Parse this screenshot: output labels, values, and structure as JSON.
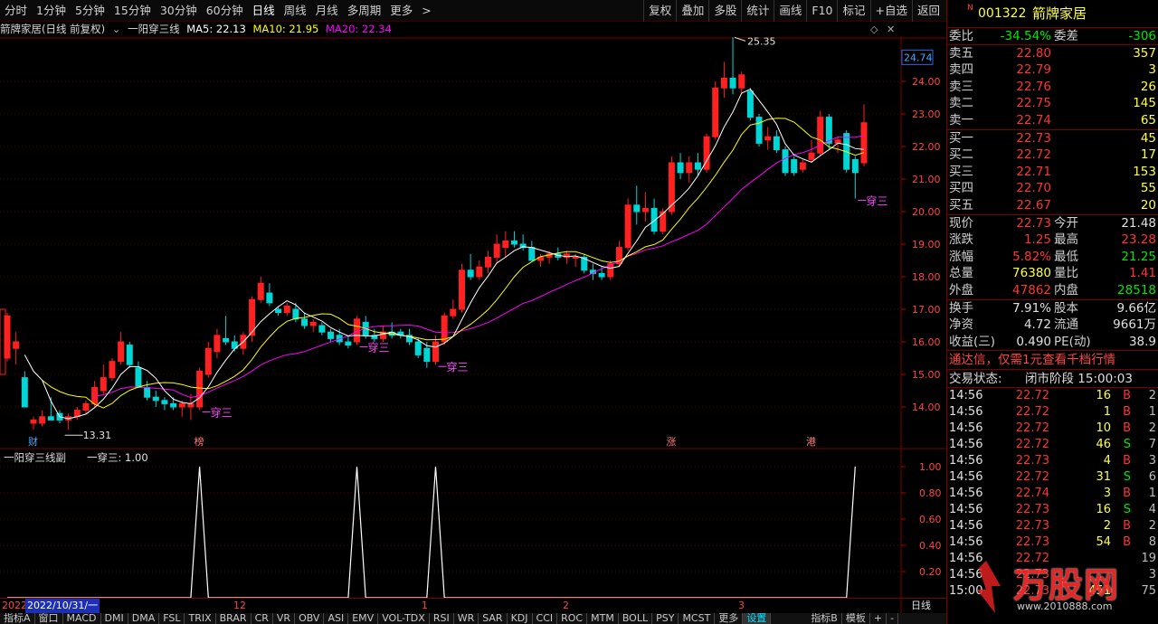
{
  "toolbar": {
    "periods": [
      "分时",
      "1分钟",
      "5分钟",
      "15分钟",
      "30分钟",
      "60分钟",
      "日线",
      "周线",
      "月线",
      "多周期",
      "更多"
    ],
    "active_period": "日线",
    "more_arrow": ">",
    "buttons": [
      "复权",
      "叠加",
      "多股",
      "统计",
      "画线",
      "F10",
      "标记",
      "+自选",
      "返回"
    ]
  },
  "header": {
    "title": "箭牌家居(日线 前复权)",
    "indicator": "一阳穿三线",
    "ma5": "MA5: 22.13",
    "ma10": "MA10: 21.95",
    "ma20": "MA20: 22.34",
    "ma5_color": "#ffffff",
    "ma10_color": "#ffff00",
    "ma20_color": "#ff00ff"
  },
  "main_chart": {
    "y_ticks": [
      "24.00",
      "23.00",
      "22.00",
      "21.00",
      "20.00",
      "19.00",
      "18.00",
      "17.00",
      "16.00",
      "15.00",
      "14.00"
    ],
    "current_price_tag": "24.74",
    "high_label": "25.35",
    "low_label": "13.31",
    "signal_label": "穿三",
    "markers": [
      "财",
      "榜",
      "涨",
      "港"
    ]
  },
  "sub_chart": {
    "title": "一阳穿三线副",
    "value_label": "一穿三: 1.00",
    "y_ticks": [
      "1.00",
      "0.80",
      "0.60",
      "0.40",
      "0.20"
    ]
  },
  "date_axis": {
    "labels": [
      "2022",
      "2022/10/31/一",
      "12",
      "1",
      "2",
      "3"
    ],
    "right_label": "日线"
  },
  "bottom_tabs": [
    "指标A",
    "窗口",
    "MACD",
    "DMI",
    "DMA",
    "FSL",
    "TRIX",
    "BRAR",
    "CR",
    "VR",
    "OBV",
    "ASI",
    "EMV",
    "VOL-TDX",
    "RSI",
    "WR",
    "SAR",
    "KDJ",
    "CCI",
    "ROC",
    "MTM",
    "BOLL",
    "PSY",
    "MCST",
    "更多",
    "设置",
    "指标B",
    "模板",
    "+",
    "-"
  ],
  "chart_data": {
    "type": "candlestick",
    "title": "箭牌家居(日线 前复权)",
    "ylim": [
      13.2,
      25.6
    ],
    "candles": [
      {
        "o": 15.5,
        "h": 16.9,
        "l": 15.4,
        "c": 16.8
      },
      {
        "o": 15.8,
        "h": 16.3,
        "l": 15.3,
        "c": 16.0
      },
      {
        "o": 14.9,
        "h": 15.1,
        "l": 14.0,
        "c": 14.0
      },
      {
        "o": 13.5,
        "h": 13.7,
        "l": 13.31,
        "c": 13.6
      },
      {
        "o": 13.5,
        "h": 13.9,
        "l": 13.4,
        "c": 13.7
      },
      {
        "o": 13.7,
        "h": 14.3,
        "l": 13.6,
        "c": 13.6
      },
      {
        "o": 13.8,
        "h": 13.9,
        "l": 13.5,
        "c": 13.6
      },
      {
        "o": 13.6,
        "h": 13.8,
        "l": 13.3,
        "c": 13.7
      },
      {
        "o": 13.7,
        "h": 14.0,
        "l": 13.6,
        "c": 13.9
      },
      {
        "o": 13.9,
        "h": 14.2,
        "l": 13.8,
        "c": 14.1
      },
      {
        "o": 14.1,
        "h": 14.8,
        "l": 14.0,
        "c": 14.6
      },
      {
        "o": 14.5,
        "h": 15.3,
        "l": 14.4,
        "c": 14.9
      },
      {
        "o": 14.9,
        "h": 15.5,
        "l": 14.8,
        "c": 15.4
      },
      {
        "o": 15.4,
        "h": 16.3,
        "l": 15.3,
        "c": 16.0
      },
      {
        "o": 15.9,
        "h": 16.0,
        "l": 15.2,
        "c": 15.3
      },
      {
        "o": 15.2,
        "h": 15.4,
        "l": 14.6,
        "c": 14.6
      },
      {
        "o": 14.6,
        "h": 14.8,
        "l": 14.2,
        "c": 14.3
      },
      {
        "o": 14.3,
        "h": 14.5,
        "l": 14.0,
        "c": 14.2
      },
      {
        "o": 14.2,
        "h": 14.3,
        "l": 13.9,
        "c": 14.1
      },
      {
        "o": 14.1,
        "h": 14.3,
        "l": 13.9,
        "c": 14.0
      },
      {
        "o": 14.0,
        "h": 14.2,
        "l": 13.7,
        "c": 14.1
      },
      {
        "o": 14.0,
        "h": 14.4,
        "l": 13.6,
        "c": 14.1
      },
      {
        "o": 14.0,
        "h": 15.2,
        "l": 13.9,
        "c": 15.1
      },
      {
        "o": 15.0,
        "h": 16.0,
        "l": 14.9,
        "c": 15.8
      },
      {
        "o": 15.7,
        "h": 16.4,
        "l": 15.5,
        "c": 16.2
      },
      {
        "o": 16.1,
        "h": 16.8,
        "l": 15.9,
        "c": 16.0
      },
      {
        "o": 16.0,
        "h": 16.2,
        "l": 15.7,
        "c": 15.8
      },
      {
        "o": 15.8,
        "h": 16.3,
        "l": 15.6,
        "c": 16.2
      },
      {
        "o": 16.2,
        "h": 17.4,
        "l": 16.0,
        "c": 17.3
      },
      {
        "o": 17.3,
        "h": 18.0,
        "l": 17.2,
        "c": 17.8
      },
      {
        "o": 17.5,
        "h": 17.8,
        "l": 17.1,
        "c": 17.2
      },
      {
        "o": 17.0,
        "h": 17.1,
        "l": 16.8,
        "c": 16.9
      },
      {
        "o": 16.9,
        "h": 17.2,
        "l": 16.8,
        "c": 17.1
      },
      {
        "o": 17.0,
        "h": 17.2,
        "l": 16.6,
        "c": 16.7
      },
      {
        "o": 16.7,
        "h": 16.9,
        "l": 16.4,
        "c": 16.5
      },
      {
        "o": 16.5,
        "h": 16.7,
        "l": 16.3,
        "c": 16.6
      },
      {
        "o": 16.5,
        "h": 16.6,
        "l": 16.2,
        "c": 16.3
      },
      {
        "o": 16.3,
        "h": 16.4,
        "l": 16.0,
        "c": 16.1
      },
      {
        "o": 16.2,
        "h": 16.4,
        "l": 15.9,
        "c": 16.0
      },
      {
        "o": 16.0,
        "h": 16.2,
        "l": 15.8,
        "c": 15.9
      },
      {
        "o": 16.0,
        "h": 16.8,
        "l": 15.9,
        "c": 16.7
      },
      {
        "o": 16.6,
        "h": 16.8,
        "l": 16.1,
        "c": 16.2
      },
      {
        "o": 16.2,
        "h": 16.4,
        "l": 16.0,
        "c": 16.1
      },
      {
        "o": 16.1,
        "h": 16.5,
        "l": 16.0,
        "c": 16.3
      },
      {
        "o": 16.3,
        "h": 16.6,
        "l": 16.1,
        "c": 16.2
      },
      {
        "o": 16.3,
        "h": 16.4,
        "l": 16.1,
        "c": 16.2
      },
      {
        "o": 16.2,
        "h": 16.4,
        "l": 15.9,
        "c": 16.0
      },
      {
        "o": 16.0,
        "h": 16.1,
        "l": 15.5,
        "c": 15.6
      },
      {
        "o": 15.8,
        "h": 16.0,
        "l": 15.2,
        "c": 15.4
      },
      {
        "o": 15.4,
        "h": 16.2,
        "l": 15.3,
        "c": 16.0
      },
      {
        "o": 16.0,
        "h": 16.9,
        "l": 15.9,
        "c": 16.8
      },
      {
        "o": 16.8,
        "h": 17.3,
        "l": 16.7,
        "c": 17.0
      },
      {
        "o": 17.0,
        "h": 18.4,
        "l": 16.9,
        "c": 18.2
      },
      {
        "o": 18.2,
        "h": 18.7,
        "l": 17.9,
        "c": 18.0
      },
      {
        "o": 18.0,
        "h": 18.5,
        "l": 17.9,
        "c": 18.3
      },
      {
        "o": 18.3,
        "h": 18.8,
        "l": 18.1,
        "c": 18.6
      },
      {
        "o": 18.6,
        "h": 19.3,
        "l": 18.4,
        "c": 19.0
      },
      {
        "o": 18.9,
        "h": 19.4,
        "l": 18.6,
        "c": 19.1
      },
      {
        "o": 19.1,
        "h": 19.4,
        "l": 18.9,
        "c": 19.0
      },
      {
        "o": 19.0,
        "h": 19.3,
        "l": 18.8,
        "c": 18.9
      },
      {
        "o": 18.9,
        "h": 19.1,
        "l": 18.5,
        "c": 18.5
      },
      {
        "o": 18.5,
        "h": 18.7,
        "l": 18.3,
        "c": 18.6
      },
      {
        "o": 18.6,
        "h": 18.8,
        "l": 18.4,
        "c": 18.7
      },
      {
        "o": 18.7,
        "h": 18.9,
        "l": 18.5,
        "c": 18.6
      },
      {
        "o": 18.6,
        "h": 18.8,
        "l": 18.4,
        "c": 18.7
      },
      {
        "o": 18.6,
        "h": 18.7,
        "l": 18.3,
        "c": 18.6
      },
      {
        "o": 18.6,
        "h": 18.7,
        "l": 18.1,
        "c": 18.2
      },
      {
        "o": 18.2,
        "h": 18.4,
        "l": 17.9,
        "c": 18.1
      },
      {
        "o": 18.1,
        "h": 18.3,
        "l": 17.9,
        "c": 18.0
      },
      {
        "o": 18.0,
        "h": 18.5,
        "l": 17.9,
        "c": 18.4
      },
      {
        "o": 18.4,
        "h": 19.1,
        "l": 18.3,
        "c": 18.9
      },
      {
        "o": 18.9,
        "h": 20.4,
        "l": 18.8,
        "c": 20.2
      },
      {
        "o": 20.2,
        "h": 20.8,
        "l": 19.6,
        "c": 20.0
      },
      {
        "o": 20.0,
        "h": 20.6,
        "l": 19.7,
        "c": 20.1
      },
      {
        "o": 20.1,
        "h": 20.4,
        "l": 19.3,
        "c": 19.4
      },
      {
        "o": 19.4,
        "h": 20.1,
        "l": 19.3,
        "c": 20.0
      },
      {
        "o": 20.0,
        "h": 21.7,
        "l": 19.9,
        "c": 21.5
      },
      {
        "o": 21.5,
        "h": 21.8,
        "l": 21.0,
        "c": 21.2
      },
      {
        "o": 21.2,
        "h": 21.7,
        "l": 20.9,
        "c": 21.5
      },
      {
        "o": 21.5,
        "h": 21.8,
        "l": 21.1,
        "c": 21.3
      },
      {
        "o": 21.3,
        "h": 22.4,
        "l": 21.2,
        "c": 22.3
      },
      {
        "o": 22.3,
        "h": 24.0,
        "l": 22.2,
        "c": 23.8
      },
      {
        "o": 23.8,
        "h": 24.6,
        "l": 23.5,
        "c": 24.1
      },
      {
        "o": 24.1,
        "h": 25.35,
        "l": 23.6,
        "c": 23.8
      },
      {
        "o": 23.8,
        "h": 24.3,
        "l": 23.6,
        "c": 24.2
      },
      {
        "o": 23.7,
        "h": 23.8,
        "l": 22.8,
        "c": 22.9
      },
      {
        "o": 22.9,
        "h": 23.0,
        "l": 22.0,
        "c": 22.1
      },
      {
        "o": 22.2,
        "h": 22.6,
        "l": 21.9,
        "c": 22.3
      },
      {
        "o": 22.3,
        "h": 22.5,
        "l": 21.8,
        "c": 21.9
      },
      {
        "o": 21.9,
        "h": 22.0,
        "l": 21.1,
        "c": 21.2
      },
      {
        "o": 21.6,
        "h": 21.7,
        "l": 21.1,
        "c": 21.2
      },
      {
        "o": 21.3,
        "h": 21.6,
        "l": 21.2,
        "c": 21.5
      },
      {
        "o": 21.6,
        "h": 22.2,
        "l": 21.5,
        "c": 21.8
      },
      {
        "o": 21.8,
        "h": 23.1,
        "l": 21.7,
        "c": 22.9
      },
      {
        "o": 22.9,
        "h": 23.0,
        "l": 21.9,
        "c": 22.1
      },
      {
        "o": 22.1,
        "h": 22.3,
        "l": 21.8,
        "c": 22.2
      },
      {
        "o": 22.4,
        "h": 22.5,
        "l": 21.2,
        "c": 21.3
      },
      {
        "o": 21.6,
        "h": 21.7,
        "l": 20.4,
        "c": 21.2
      },
      {
        "o": 21.5,
        "h": 23.3,
        "l": 21.4,
        "c": 22.73
      }
    ],
    "signal_series": [
      0,
      0,
      0,
      0,
      0,
      0,
      0,
      0,
      0,
      0,
      0,
      0,
      0,
      0,
      0,
      0,
      0,
      0,
      0,
      0,
      0,
      0,
      1,
      0,
      0,
      0,
      0,
      0,
      0,
      0,
      0,
      0,
      0,
      0,
      0,
      0,
      0,
      0,
      0,
      0,
      1,
      0,
      0,
      0,
      0,
      0,
      0,
      0,
      0,
      1,
      0,
      0,
      0,
      0,
      0,
      0,
      0,
      0,
      0,
      0,
      0,
      0,
      0,
      0,
      0,
      0,
      0,
      0,
      0,
      0,
      0,
      0,
      0,
      0,
      0,
      0,
      0,
      0,
      0,
      0,
      0,
      0,
      0,
      0,
      0,
      0,
      0,
      0,
      0,
      0,
      0,
      0,
      0,
      0,
      0,
      0,
      0,
      1
    ]
  },
  "quote_panel": {
    "code": "001322",
    "name": "箭牌家居",
    "flag": "N",
    "weibi_label": "委比",
    "weibi": "-34.54%",
    "weicha_label": "委差",
    "weicha": "-306",
    "asks": [
      {
        "label": "卖五",
        "price": "22.80",
        "vol": "357"
      },
      {
        "label": "卖四",
        "price": "22.79",
        "vol": "3"
      },
      {
        "label": "卖三",
        "price": "22.76",
        "vol": "26"
      },
      {
        "label": "卖二",
        "price": "22.75",
        "vol": "145"
      },
      {
        "label": "卖一",
        "price": "22.74",
        "vol": "65"
      }
    ],
    "bids": [
      {
        "label": "买一",
        "price": "22.73",
        "vol": "45"
      },
      {
        "label": "买二",
        "price": "22.72",
        "vol": "17"
      },
      {
        "label": "买三",
        "price": "22.71",
        "vol": "153"
      },
      {
        "label": "买四",
        "price": "22.70",
        "vol": "55"
      },
      {
        "label": "买五",
        "price": "22.67",
        "vol": "20"
      }
    ],
    "stats": [
      {
        "l1": "现价",
        "v1": "22.73",
        "c1": "red",
        "l2": "今开",
        "v2": "21.48",
        "c2": "white"
      },
      {
        "l1": "涨跌",
        "v1": "1.25",
        "c1": "red",
        "l2": "最高",
        "v2": "23.28",
        "c2": "red"
      },
      {
        "l1": "涨幅",
        "v1": "5.82%",
        "c1": "red",
        "l2": "最低",
        "v2": "21.25",
        "c2": "green"
      },
      {
        "l1": "总量",
        "v1": "76380",
        "c1": "yellow",
        "l2": "量比",
        "v2": "1.41",
        "c2": "red"
      },
      {
        "l1": "外盘",
        "v1": "47862",
        "c1": "red",
        "l2": "内盘",
        "v2": "28518",
        "c2": "green"
      }
    ],
    "stats2": [
      {
        "l1": "换手",
        "v1": "7.91%",
        "l2": "股本",
        "v2": "9.66亿"
      },
      {
        "l1": "净资",
        "v1": "4.72",
        "l2": "流通",
        "v2": "9661万"
      },
      {
        "l1": "收益(三)",
        "v1": "0.490",
        "l2": "PE(动)",
        "v2": "38.9"
      }
    ],
    "promo": "通达信，仅需1元查看千档行情",
    "trade_status_label": "交易状态:",
    "trade_status": "闭市阶段 15:00:03",
    "ticks": [
      {
        "t": "14:56",
        "p": "22.72",
        "v": "16",
        "s": "B",
        "n": "2"
      },
      {
        "t": "14:56",
        "p": "22.72",
        "v": "1",
        "s": "B",
        "n": "1"
      },
      {
        "t": "14:56",
        "p": "22.72",
        "v": "10",
        "s": "B",
        "n": "2"
      },
      {
        "t": "14:56",
        "p": "22.72",
        "v": "46",
        "s": "S",
        "n": "7"
      },
      {
        "t": "14:56",
        "p": "22.73",
        "v": "4",
        "s": "B",
        "n": "3"
      },
      {
        "t": "14:56",
        "p": "22.72",
        "v": "31",
        "s": "S",
        "n": "6"
      },
      {
        "t": "14:56",
        "p": "22.74",
        "v": "3",
        "s": "B",
        "n": "1"
      },
      {
        "t": "14:56",
        "p": "22.73",
        "v": "16",
        "s": "S",
        "n": "4"
      },
      {
        "t": "14:56",
        "p": "22.73",
        "v": "2",
        "s": "B",
        "n": "2"
      },
      {
        "t": "14:56",
        "p": "22.73",
        "v": "54",
        "s": "B",
        "n": "8"
      },
      {
        "t": "14:56",
        "p": "22.72",
        "v": "",
        "s": "",
        "n": "19"
      },
      {
        "t": "14:56",
        "p": "22.73",
        "v": "",
        "s": "",
        "n": "3"
      },
      {
        "t": "15:00",
        "p": "22.73",
        "v": "451",
        "s": "",
        "n": "75"
      }
    ],
    "watermark": "万股网",
    "watermark_url": "www.2010888.com"
  }
}
